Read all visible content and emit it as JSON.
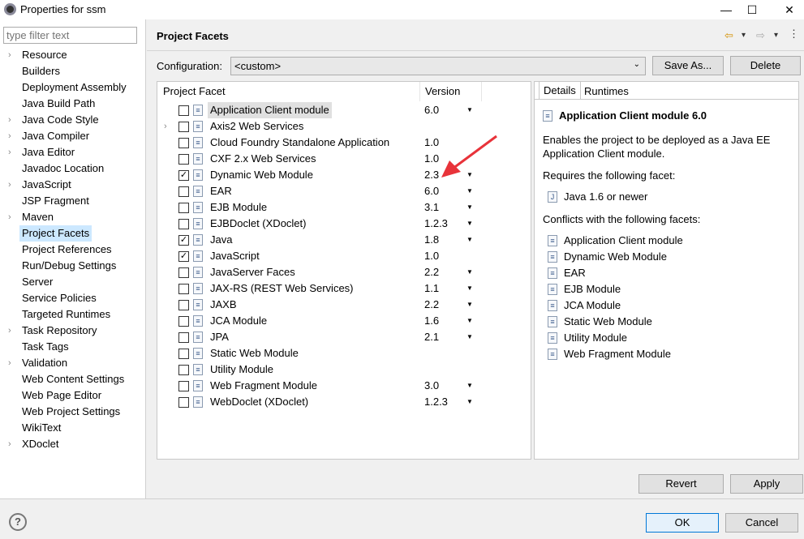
{
  "window": {
    "title": "Properties for ssm",
    "minimize": "—",
    "maximize": "☐",
    "close": "✕"
  },
  "sidebar": {
    "filter_placeholder": "type filter text",
    "items": [
      {
        "label": "Resource",
        "expand": true
      },
      {
        "label": "Builders"
      },
      {
        "label": "Deployment Assembly"
      },
      {
        "label": "Java Build Path"
      },
      {
        "label": "Java Code Style",
        "expand": true
      },
      {
        "label": "Java Compiler",
        "expand": true
      },
      {
        "label": "Java Editor",
        "expand": true
      },
      {
        "label": "Javadoc Location"
      },
      {
        "label": "JavaScript",
        "expand": true
      },
      {
        "label": "JSP Fragment"
      },
      {
        "label": "Maven",
        "expand": true
      },
      {
        "label": "Project Facets",
        "selected": true
      },
      {
        "label": "Project References"
      },
      {
        "label": "Run/Debug Settings"
      },
      {
        "label": "Server"
      },
      {
        "label": "Service Policies"
      },
      {
        "label": "Targeted Runtimes"
      },
      {
        "label": "Task Repository",
        "expand": true
      },
      {
        "label": "Task Tags"
      },
      {
        "label": "Validation",
        "expand": true
      },
      {
        "label": "Web Content Settings"
      },
      {
        "label": "Web Page Editor"
      },
      {
        "label": "Web Project Settings"
      },
      {
        "label": "WikiText"
      },
      {
        "label": "XDoclet",
        "expand": true
      }
    ]
  },
  "header": {
    "title": "Project Facets",
    "back": "⇦",
    "forward": "⇨",
    "dropdown": "▾"
  },
  "config": {
    "label": "Configuration:",
    "value": "<custom>",
    "save_as": "Save As...",
    "delete": "Delete"
  },
  "table": {
    "col_facet": "Project Facet",
    "col_version": "Version",
    "rows": [
      {
        "name": "Application Client module",
        "version": "6.0",
        "dd": true,
        "checked": false,
        "highlight": true
      },
      {
        "name": "Axis2 Web Services",
        "version": "",
        "dd": false,
        "checked": false,
        "expand": true
      },
      {
        "name": "Cloud Foundry Standalone Application",
        "version": "1.0",
        "dd": false,
        "checked": false
      },
      {
        "name": "CXF 2.x Web Services",
        "version": "1.0",
        "dd": false,
        "checked": false
      },
      {
        "name": "Dynamic Web Module",
        "version": "2.3",
        "dd": true,
        "checked": true
      },
      {
        "name": "EAR",
        "version": "6.0",
        "dd": true,
        "checked": false
      },
      {
        "name": "EJB Module",
        "version": "3.1",
        "dd": true,
        "checked": false
      },
      {
        "name": "EJBDoclet (XDoclet)",
        "version": "1.2.3",
        "dd": true,
        "checked": false
      },
      {
        "name": "Java",
        "version": "1.8",
        "dd": true,
        "checked": true
      },
      {
        "name": "JavaScript",
        "version": "1.0",
        "dd": false,
        "checked": true
      },
      {
        "name": "JavaServer Faces",
        "version": "2.2",
        "dd": true,
        "checked": false
      },
      {
        "name": "JAX-RS (REST Web Services)",
        "version": "1.1",
        "dd": true,
        "checked": false
      },
      {
        "name": "JAXB",
        "version": "2.2",
        "dd": true,
        "checked": false
      },
      {
        "name": "JCA Module",
        "version": "1.6",
        "dd": true,
        "checked": false
      },
      {
        "name": "JPA",
        "version": "2.1",
        "dd": true,
        "checked": false
      },
      {
        "name": "Static Web Module",
        "version": "",
        "dd": false,
        "checked": false
      },
      {
        "name": "Utility Module",
        "version": "",
        "dd": false,
        "checked": false
      },
      {
        "name": "Web Fragment Module",
        "version": "3.0",
        "dd": true,
        "checked": false
      },
      {
        "name": "WebDoclet (XDoclet)",
        "version": "1.2.3",
        "dd": true,
        "checked": false
      }
    ]
  },
  "details": {
    "tab_details": "Details",
    "tab_runtimes": "Runtimes",
    "title": "Application Client module 6.0",
    "desc1": "Enables the project to be deployed as a Java EE",
    "desc2": "Application Client module.",
    "requires_label": "Requires the following facet:",
    "requires": [
      "Java 1.6 or newer"
    ],
    "conflicts_label": "Conflicts with the following facets:",
    "conflicts": [
      "Application Client module",
      "Dynamic Web Module",
      "EAR",
      "EJB Module",
      "JCA Module",
      "Static Web Module",
      "Utility Module",
      "Web Fragment Module"
    ]
  },
  "buttons": {
    "revert": "Revert",
    "apply": "Apply",
    "ok": "OK",
    "cancel": "Cancel",
    "help": "?"
  },
  "colors": {
    "annotation_arrow": "#e8333a",
    "ok_border": "#0078d7"
  }
}
